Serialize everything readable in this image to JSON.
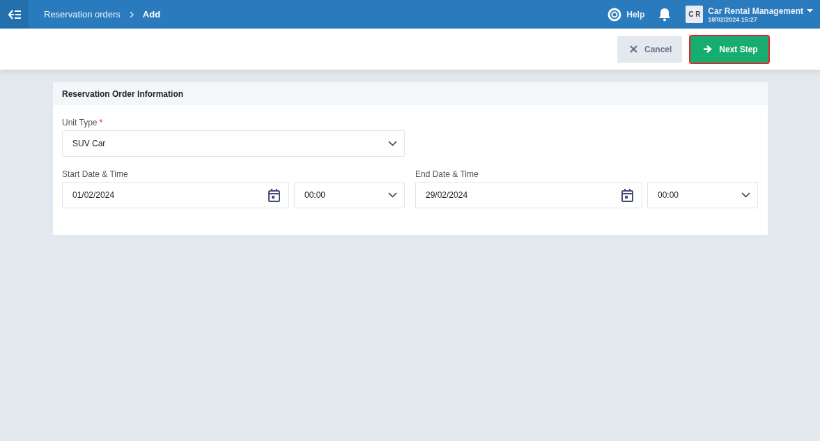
{
  "topbar": {
    "breadcrumb": [
      "Reservation orders",
      "Add"
    ],
    "help": "Help",
    "account": {
      "initials": "C R",
      "name": "Car Rental Management",
      "datetime": "18/02/2024 15:27"
    }
  },
  "actions": [
    {
      "kind": "cancel",
      "label": "Cancel",
      "highlighted": false
    },
    {
      "kind": "next",
      "label": "Next Step",
      "highlighted": true
    }
  ],
  "card": {
    "title": "Reservation Order Information",
    "unit_type": {
      "label": "Unit Type",
      "required_mark": "*",
      "value": "SUV Car"
    },
    "ranges": [
      {
        "label": "Start Date & Time",
        "date": "01/02/2024",
        "time": "00:00"
      },
      {
        "label": "End Date & Time",
        "date": "29/02/2024",
        "time": "00:00"
      }
    ]
  }
}
